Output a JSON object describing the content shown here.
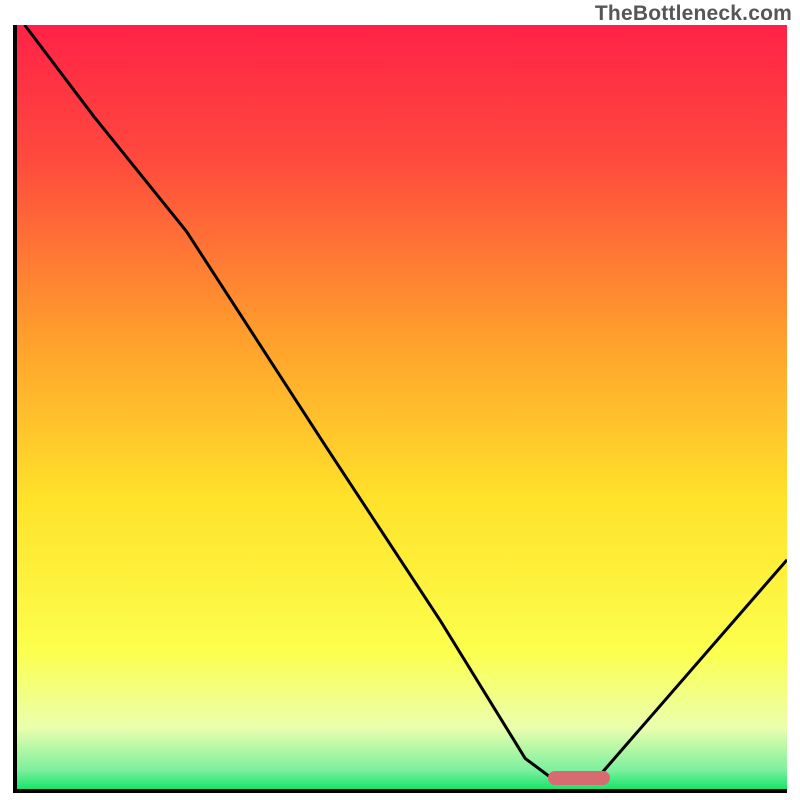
{
  "attribution": "TheBottleneck.com",
  "chart_data": {
    "type": "line",
    "title": "",
    "xlabel": "",
    "ylabel": "",
    "xlim": [
      0,
      100
    ],
    "ylim": [
      0,
      100
    ],
    "x": [
      1,
      10,
      22,
      40,
      55,
      66,
      70,
      75,
      100
    ],
    "values": [
      100,
      88,
      73,
      45,
      22,
      4,
      1,
      1,
      30
    ],
    "optimum_x_range": [
      69,
      77
    ],
    "optimum_y": 1.5,
    "marker_color": "#d86b72",
    "gradient_stops": [
      {
        "offset": 0.0,
        "color": "#ff2247"
      },
      {
        "offset": 0.18,
        "color": "#ff4b3d"
      },
      {
        "offset": 0.4,
        "color": "#ff9c2d"
      },
      {
        "offset": 0.62,
        "color": "#ffe22a"
      },
      {
        "offset": 0.82,
        "color": "#fcff4d"
      },
      {
        "offset": 0.92,
        "color": "#eaffae"
      },
      {
        "offset": 0.975,
        "color": "#7df09e"
      },
      {
        "offset": 1.0,
        "color": "#17e56a"
      }
    ]
  }
}
